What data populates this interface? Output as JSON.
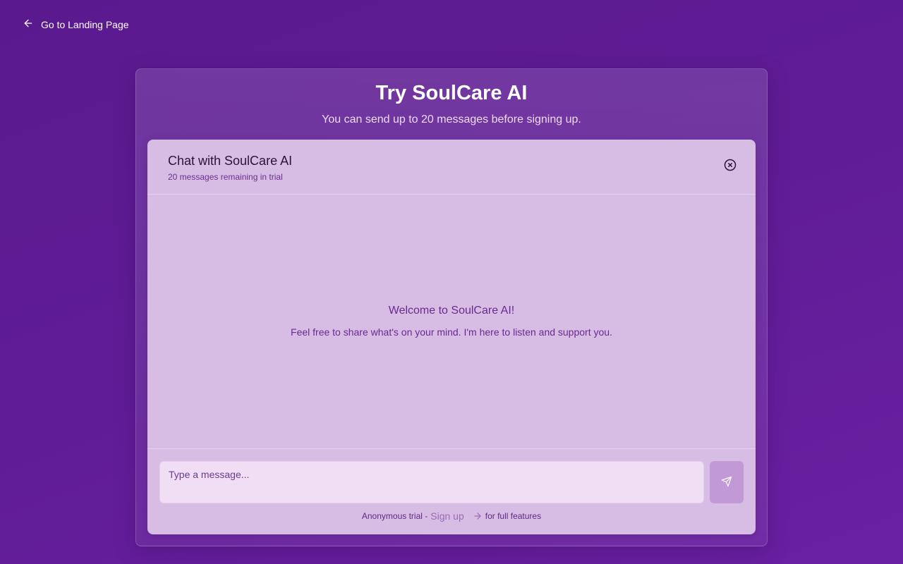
{
  "nav": {
    "back_label": "Go to Landing Page"
  },
  "page": {
    "title": "Try SoulCare AI",
    "subtitle": "You can send up to 20 messages before signing up."
  },
  "chat": {
    "title": "Chat with SoulCare AI",
    "remaining": "20 messages remaining in trial",
    "welcome_title": "Welcome to SoulCare AI!",
    "welcome_text": "Feel free to share what's on your mind. I'm here to listen and support you.",
    "input_placeholder": "Type a message...",
    "input_value": "",
    "trial_prefix": "Anonymous trial -",
    "signup_label": "Sign up",
    "trial_suffix": "for full features"
  },
  "icons": {
    "back": "arrow-left-icon",
    "close": "circle-x-icon",
    "send": "send-icon",
    "arrow": "arrow-right-icon"
  },
  "colors": {
    "background": "#5f1c94",
    "chat_card": "#d7bde4",
    "input_bg": "#efdef4",
    "send_button": "#c199d6",
    "accent_text": "#6a2890"
  }
}
